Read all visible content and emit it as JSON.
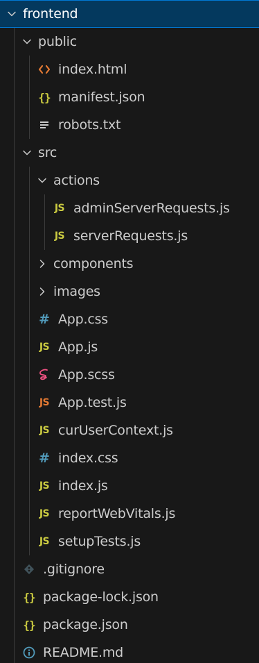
{
  "explorer": {
    "items": [
      {
        "label": "frontend",
        "type": "folder",
        "expanded": true,
        "depth": 0,
        "selected": true
      },
      {
        "label": "public",
        "type": "folder",
        "expanded": true,
        "depth": 1
      },
      {
        "label": "index.html",
        "type": "file",
        "icon": "html-icon",
        "depth": 2
      },
      {
        "label": "manifest.json",
        "type": "file",
        "icon": "json-icon",
        "depth": 2
      },
      {
        "label": "robots.txt",
        "type": "file",
        "icon": "text-file-icon",
        "depth": 2
      },
      {
        "label": "src",
        "type": "folder",
        "expanded": true,
        "depth": 1
      },
      {
        "label": "actions",
        "type": "folder",
        "expanded": true,
        "depth": 2
      },
      {
        "label": "adminServerRequests.js",
        "type": "file",
        "icon": "js-icon",
        "depth": 3
      },
      {
        "label": "serverRequests.js",
        "type": "file",
        "icon": "js-icon",
        "depth": 3
      },
      {
        "label": "components",
        "type": "folder",
        "expanded": false,
        "depth": 2
      },
      {
        "label": "images",
        "type": "folder",
        "expanded": false,
        "depth": 2
      },
      {
        "label": "App.css",
        "type": "file",
        "icon": "css-icon",
        "depth": 2
      },
      {
        "label": "App.js",
        "type": "file",
        "icon": "js-icon",
        "depth": 2
      },
      {
        "label": "App.scss",
        "type": "file",
        "icon": "sass-icon",
        "depth": 2
      },
      {
        "label": "App.test.js",
        "type": "file",
        "icon": "js-test-icon",
        "depth": 2
      },
      {
        "label": "curUserContext.js",
        "type": "file",
        "icon": "js-icon",
        "depth": 2
      },
      {
        "label": "index.css",
        "type": "file",
        "icon": "css-icon",
        "depth": 2
      },
      {
        "label": "index.js",
        "type": "file",
        "icon": "js-icon",
        "depth": 2
      },
      {
        "label": "reportWebVitals.js",
        "type": "file",
        "icon": "js-icon",
        "depth": 2
      },
      {
        "label": "setupTests.js",
        "type": "file",
        "icon": "js-icon",
        "depth": 2
      },
      {
        "label": ".gitignore",
        "type": "file",
        "icon": "git-icon",
        "depth": 1
      },
      {
        "label": "package-lock.json",
        "type": "file",
        "icon": "json-icon",
        "depth": 1
      },
      {
        "label": "package.json",
        "type": "file",
        "icon": "json-icon",
        "depth": 1
      },
      {
        "label": "README.md",
        "type": "file",
        "icon": "info-icon",
        "depth": 1
      }
    ]
  },
  "colors": {
    "selected_bg": "#04395e",
    "selected_border": "#0078d4",
    "text": "#cccccc",
    "js": "#cbcb41",
    "js_test": "#e37933",
    "css": "#519aba",
    "html": "#e37933",
    "json": "#cbcb41",
    "sass": "#f55385",
    "git": "#41535b",
    "info": "#519aba",
    "text_file": "#cccccc"
  }
}
